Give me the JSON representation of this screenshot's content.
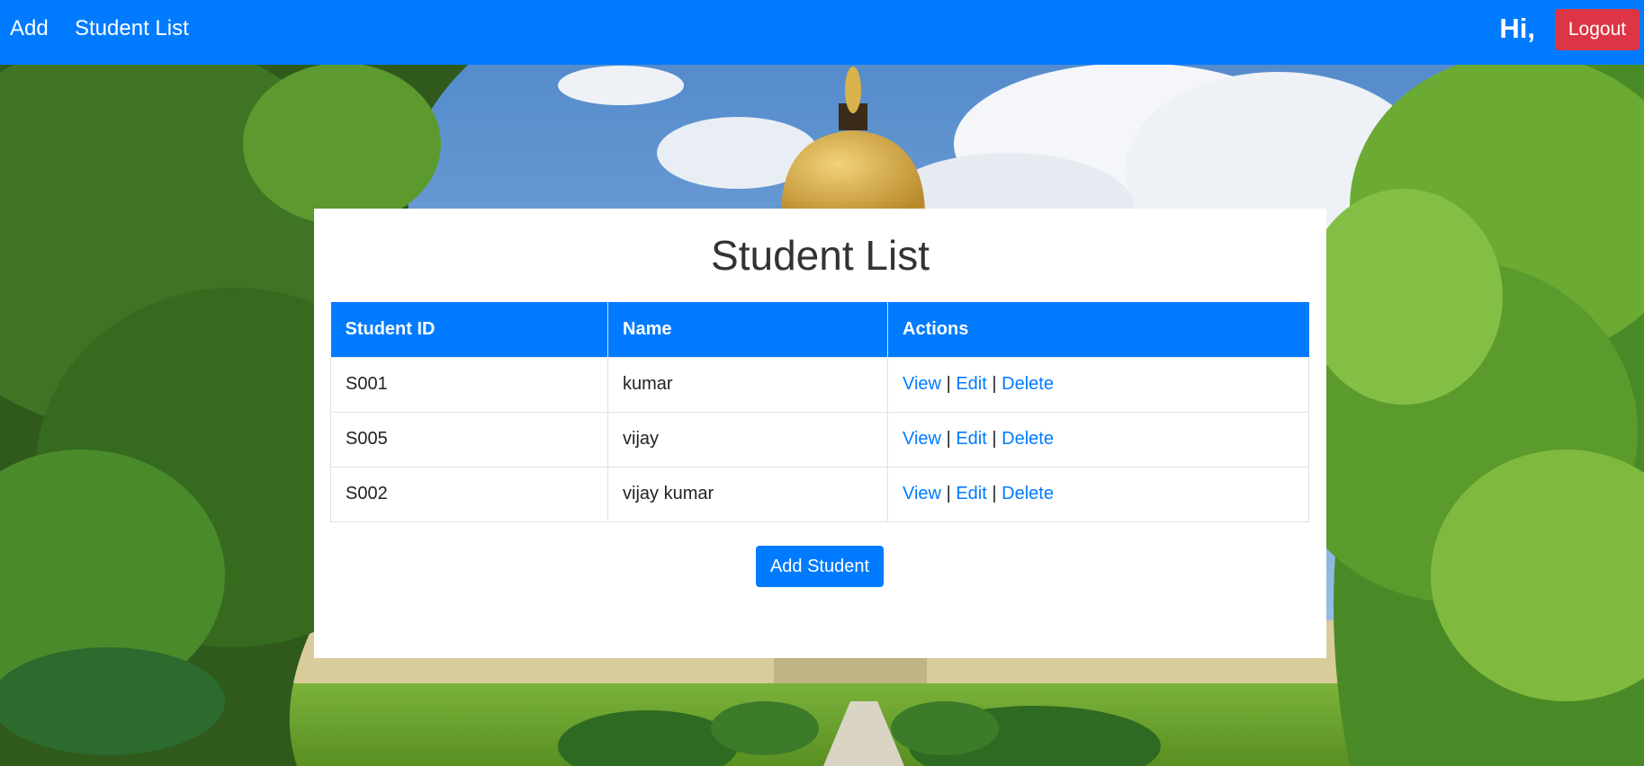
{
  "nav": {
    "add_label": "Add",
    "student_list_label": "Student List",
    "greeting": "Hi,",
    "logout_label": "Logout"
  },
  "card": {
    "title": "Student List",
    "table": {
      "headers": [
        "Student ID",
        "Name",
        "Actions"
      ],
      "rows": [
        {
          "id": "S001",
          "name": "kumar",
          "view": "View",
          "edit": "Edit",
          "delete": "Delete"
        },
        {
          "id": "S005",
          "name": "vijay",
          "view": "View",
          "edit": "Edit",
          "delete": "Delete"
        },
        {
          "id": "S002",
          "name": "vijay kumar",
          "view": "View",
          "edit": "Edit",
          "delete": "Delete"
        }
      ],
      "separator": "|"
    },
    "add_student_label": "Add Student"
  },
  "colors": {
    "primary": "#007bff",
    "danger": "#dc3545",
    "card_bg": "#ffffff"
  }
}
